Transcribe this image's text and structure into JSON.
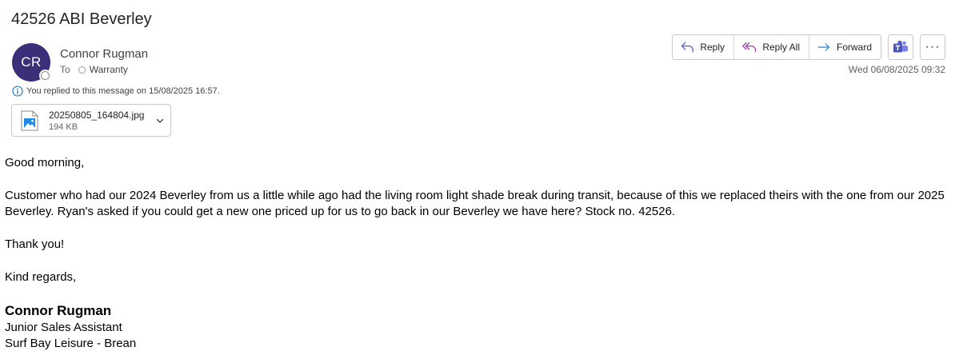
{
  "subject": "42526 ABI Beverley",
  "sender": {
    "initials": "CR",
    "name": "Connor Rugman",
    "avatar_color": "#3b2f7a"
  },
  "recipients": {
    "to_label": "To",
    "to": "Warranty"
  },
  "toolbar": {
    "reply_label": "Reply",
    "reply_all_label": "Reply All",
    "forward_label": "Forward",
    "teams_icon": "teams-icon",
    "more_icon": "more-options-icon",
    "more_glyph": "···"
  },
  "date": "Wed 06/08/2025 09:32",
  "info_notice": "You replied to this message on 15/08/2025 16:57.",
  "attachment": {
    "name": "20250805_164804.jpg",
    "size": "194 KB",
    "icon": "image-file-icon"
  },
  "body": {
    "greeting": "Good morning,",
    "paragraph": "Customer who had our 2024 Beverley from us a little while ago had the living room light shade break during transit, because of this we replaced theirs with the one from our 2025 Beverley. Ryan's asked if you could get a new one priced up for us to go back in our Beverley we have here? Stock no. 42526.",
    "thanks": "Thank you!",
    "closing": "Kind regards,"
  },
  "signature": {
    "name": "Connor Rugman",
    "title": "Junior Sales Assistant",
    "company": "Surf Bay Leisure - Brean"
  },
  "colors": {
    "reply_icon": "#5c6ac4",
    "reply_all_icon": "#9b3fa8",
    "forward_icon": "#2a7fd4",
    "info_icon": "#0f6cbd"
  }
}
